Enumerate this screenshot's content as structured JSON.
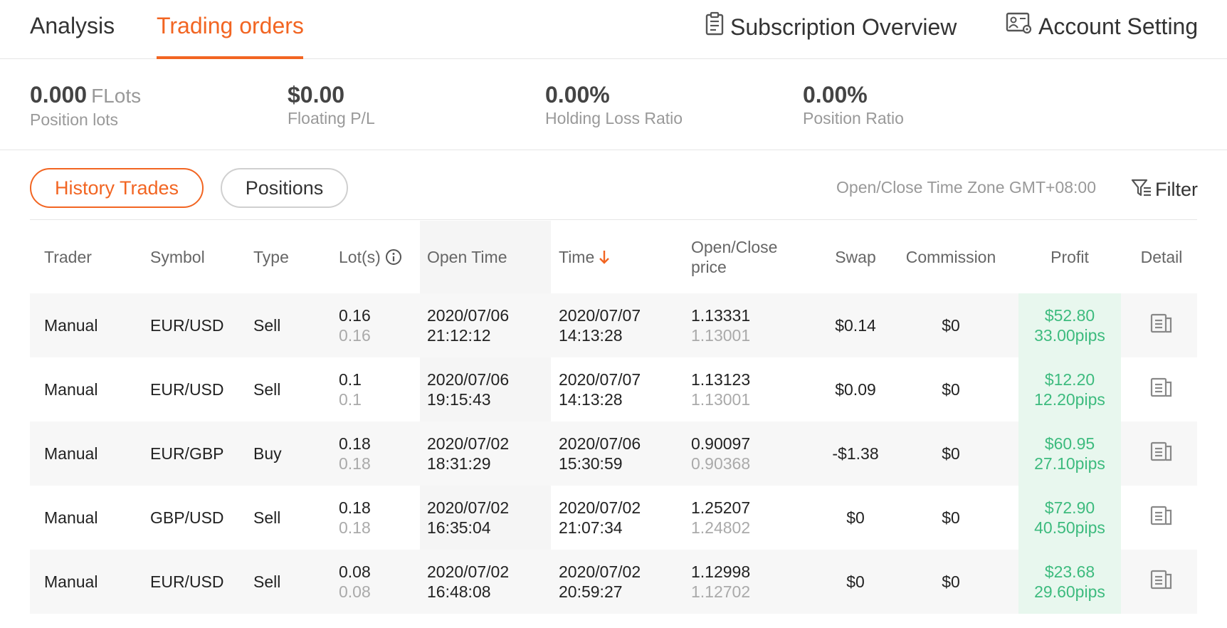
{
  "nav": {
    "tabs": [
      {
        "label": "Analysis"
      },
      {
        "label": "Trading orders"
      }
    ],
    "subscription_label": "Subscription Overview",
    "account_label": "Account Setting"
  },
  "stats": {
    "position_lots": {
      "value": "0.000",
      "unit": "FLots",
      "label": "Position lots"
    },
    "floating_pl": {
      "value": "$0.00",
      "label": "Floating P/L"
    },
    "holding_loss_ratio": {
      "value": "0.00%",
      "label": "Holding Loss Ratio"
    },
    "position_ratio": {
      "value": "0.00%",
      "label": "Position Ratio"
    }
  },
  "controls": {
    "history_trades": "History Trades",
    "positions": "Positions",
    "timezone": "Open/Close Time Zone GMT+08:00",
    "filter": "Filter"
  },
  "table": {
    "headers": {
      "trader": "Trader",
      "symbol": "Symbol",
      "type": "Type",
      "lots": "Lot(s)",
      "open_time": "Open Time",
      "time": "Time",
      "open_close_1": "Open/Close",
      "open_close_2": "price",
      "swap": "Swap",
      "commission": "Commission",
      "profit": "Profit",
      "detail": "Detail"
    },
    "rows": [
      {
        "trader": "Manual",
        "symbol": "EUR/USD",
        "type": "Sell",
        "lots": "0.16",
        "lots2": "0.16",
        "open_date": "2020/07/06",
        "open_clock": "21:12:12",
        "time_date": "2020/07/07",
        "time_clock": "14:13:28",
        "open_price": "1.13331",
        "close_price": "1.13001",
        "swap": "$0.14",
        "commission": "$0",
        "profit": "$52.80",
        "pips": "33.00pips"
      },
      {
        "trader": "Manual",
        "symbol": "EUR/USD",
        "type": "Sell",
        "lots": "0.1",
        "lots2": "0.1",
        "open_date": "2020/07/06",
        "open_clock": "19:15:43",
        "time_date": "2020/07/07",
        "time_clock": "14:13:28",
        "open_price": "1.13123",
        "close_price": "1.13001",
        "swap": "$0.09",
        "commission": "$0",
        "profit": "$12.20",
        "pips": "12.20pips"
      },
      {
        "trader": "Manual",
        "symbol": "EUR/GBP",
        "type": "Buy",
        "lots": "0.18",
        "lots2": "0.18",
        "open_date": "2020/07/02",
        "open_clock": "18:31:29",
        "time_date": "2020/07/06",
        "time_clock": "15:30:59",
        "open_price": "0.90097",
        "close_price": "0.90368",
        "swap": "-$1.38",
        "commission": "$0",
        "profit": "$60.95",
        "pips": "27.10pips"
      },
      {
        "trader": "Manual",
        "symbol": "GBP/USD",
        "type": "Sell",
        "lots": "0.18",
        "lots2": "0.18",
        "open_date": "2020/07/02",
        "open_clock": "16:35:04",
        "time_date": "2020/07/02",
        "time_clock": "21:07:34",
        "open_price": "1.25207",
        "close_price": "1.24802",
        "swap": "$0",
        "commission": "$0",
        "profit": "$72.90",
        "pips": "40.50pips"
      },
      {
        "trader": "Manual",
        "symbol": "EUR/USD",
        "type": "Sell",
        "lots": "0.08",
        "lots2": "0.08",
        "open_date": "2020/07/02",
        "open_clock": "16:48:08",
        "time_date": "2020/07/02",
        "time_clock": "20:59:27",
        "open_price": "1.12998",
        "close_price": "1.12702",
        "swap": "$0",
        "commission": "$0",
        "profit": "$23.68",
        "pips": "29.60pips"
      }
    ]
  },
  "colors": {
    "accent": "#f26522",
    "profit": "#3dbb7e",
    "profit_bg": "#e8f7ee"
  }
}
